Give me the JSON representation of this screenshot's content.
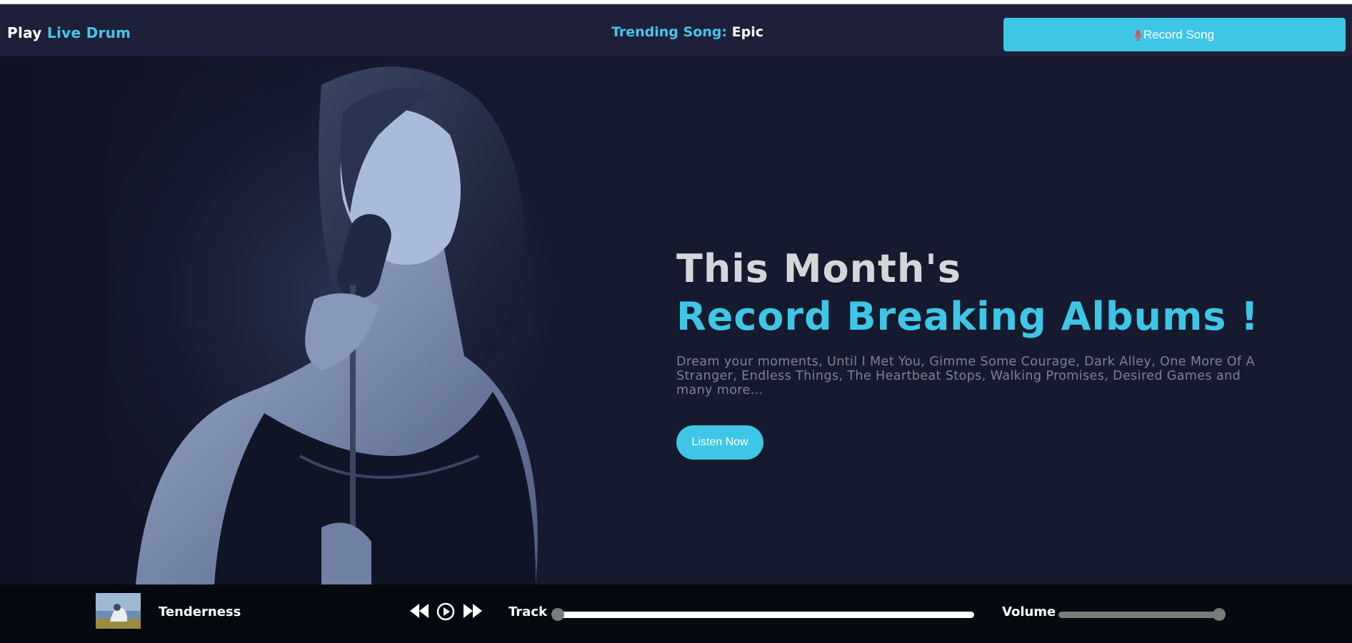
{
  "navbar": {
    "brand_play": "Play",
    "brand_live": "Live",
    "brand_drum": "Drum",
    "trending_label": "Trending Song:",
    "trending_value": "Epic",
    "record_button": "Record Song",
    "record_icon": "microphone-icon"
  },
  "hero": {
    "image": "singer-with-microphone-photo",
    "title_line1": "This Month's",
    "title_line2": "Record Breaking Albums !",
    "description": "Dream your moments, Until I Met You, Gimme Some Courage, Dark Alley, One More Of A Stranger, Endless Things, The Heartbeat Stops, Walking Promises, Desired Games and many more...",
    "listen_button": "Listen Now"
  },
  "player": {
    "song_title": "Tenderness",
    "controls": [
      "rewind-icon",
      "play-icon",
      "fast-forward-icon"
    ],
    "track_label": "Track",
    "track_progress": 0,
    "volume_label": "Volume",
    "volume_level": 1.0
  },
  "colors": {
    "accent": "#3ec6e6",
    "navbar_bg": "#1d2038",
    "hero_bg": "#151a2e",
    "player_bg": "#070911"
  }
}
